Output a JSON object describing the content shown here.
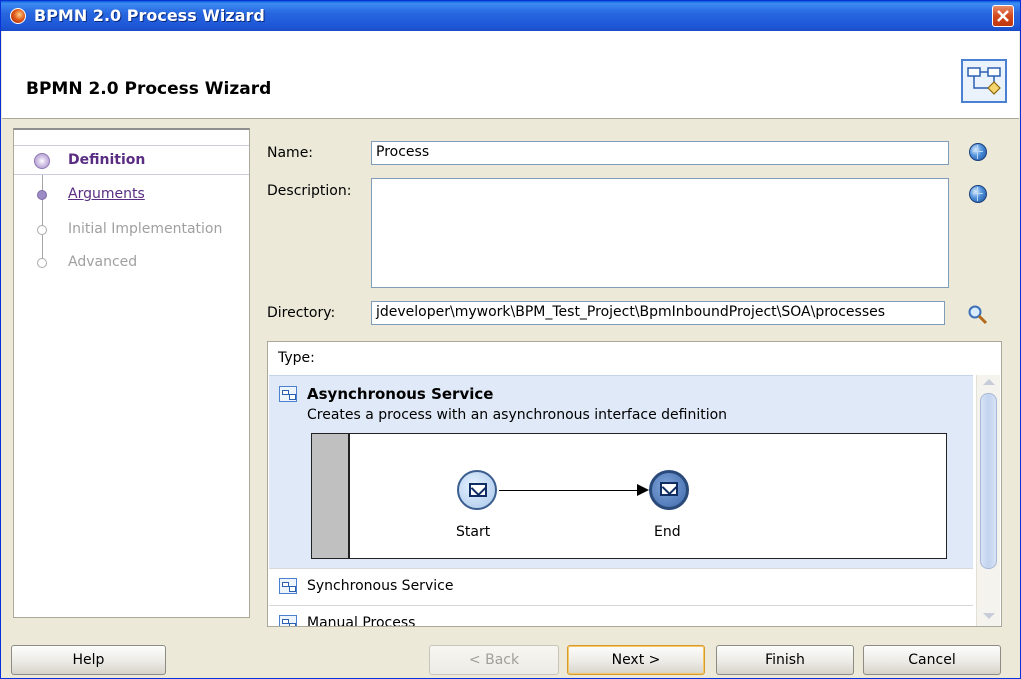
{
  "window": {
    "title": "BPMN 2.0 Process Wizard"
  },
  "header": {
    "title": "BPMN 2.0 Process Wizard"
  },
  "steps": [
    {
      "label": "Definition",
      "state": "active"
    },
    {
      "label": "Arguments",
      "state": "link"
    },
    {
      "label": "Initial Implementation",
      "state": "disabled"
    },
    {
      "label": "Advanced",
      "state": "disabled"
    }
  ],
  "form": {
    "name_label": "Name:",
    "name_value": "Process",
    "description_label": "Description:",
    "description_value": "",
    "directory_label": "Directory:",
    "directory_value": "jdeveloper\\mywork\\BPM_Test_Project\\BpmInboundProject\\SOA\\processes"
  },
  "type": {
    "label": "Type:",
    "items": [
      {
        "title": "Asynchronous Service",
        "description": "Creates a process with an asynchronous interface definition",
        "selected": true
      },
      {
        "title": "Synchronous Service",
        "selected": false
      },
      {
        "title": "Manual Process",
        "selected": false
      }
    ],
    "diagram": {
      "start_label": "Start",
      "end_label": "End"
    }
  },
  "footer": {
    "help": "Help",
    "back": "< Back",
    "next": "Next >",
    "finish": "Finish",
    "cancel": "Cancel"
  },
  "colors": {
    "titlebar": "#2867e0",
    "selection": "#dfe9f7",
    "step_active": "#5a2d82"
  }
}
